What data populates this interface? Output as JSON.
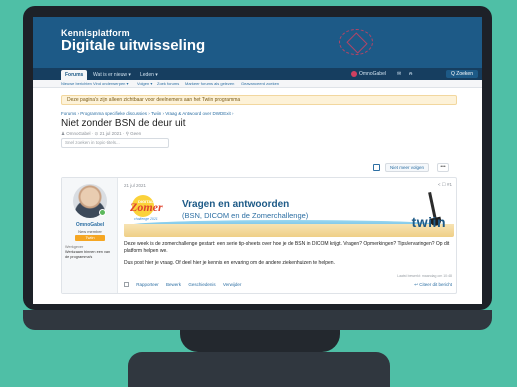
{
  "header": {
    "brand_small": "Kennisplatform",
    "brand_big": "Digitale uitwisseling"
  },
  "nav": {
    "tabs": [
      "Forums",
      "Wat is er nieuw ▾",
      "Leden ▾"
    ],
    "user": "OmnoGabel",
    "search": "Q Zoeken"
  },
  "subnav": {
    "items": [
      "Nieuwe berichten",
      "Vind onderwerpen ▾",
      "Volgen ▾",
      "Zoek forums",
      "Markeer forums als gelezen",
      "Geavanceerd zoeken"
    ]
  },
  "notice": "Deze pagina's zijn alleen zichtbaar voor deelnemers aan het Twiin programma",
  "breadcrumb": "Forums › Programma specifieke discussies › Twiin › Vraag & Antwoord over DWDExit ›",
  "thread": {
    "title": "Niet zonder BSN de deur uit",
    "meta": "♟ OmnoGabel · ⊙ 21 jul 2021 · ⚲ Geen",
    "search_placeholder": "Snel zoeken in topic-titels..."
  },
  "toolbar": {
    "follow": "Niet meer volgen",
    "more": "•••"
  },
  "post": {
    "date": "21 jul 2021",
    "actions_top": "< ☐ #1",
    "user": {
      "name": "OmnoGabel",
      "title": "New member",
      "banner": "Twiin",
      "field_label": "Werkgever",
      "field_value": "Werkzaam binnen een van de programma's"
    },
    "banner": {
      "logo_small": "DIGITALE",
      "logo": "Zomer",
      "logo_sub": "challenge 2021",
      "title": "Vragen en antwoorden",
      "subtitle": "(BSN, DICOM en de Zomerchallenge)",
      "brand": "twiin"
    },
    "body": [
      "Deze week is de zomerchallenge gestart: een serie tip-sheets over hoe je de BSN in DICOM krijgt. Vragen? Opmerkingen? Tips/ervaringen? Op dit platform helpen we.",
      "Dus post hier je vraag. Of deel hier je kennis en ervaring om de andere ziekenhuizen te helpen."
    ],
    "edit_note": "Laatst bewerkt: maandag om 10:48",
    "footer_actions": [
      "Rapporteer",
      "Bewerk",
      "Geschiedenis",
      "Verwijder"
    ],
    "quote": "↩ Citeer dit bericht"
  }
}
